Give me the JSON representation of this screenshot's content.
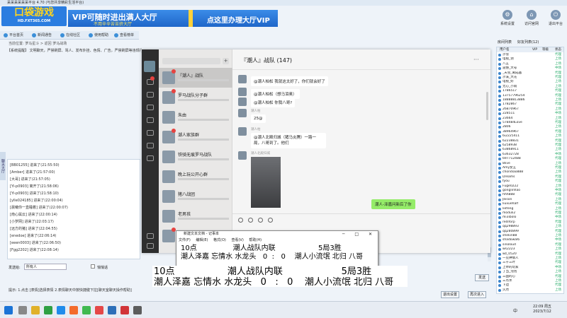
{
  "app": {
    "title": "呆呆呆呆呆呆平台 4.70 (与您共享精彩生活平台)",
    "logo": "口袋游戏",
    "logo_sub": "HD.FXT365.COM",
    "banner": {
      "line1": "VIP可随时进出满人大厅",
      "line2": "不用辛辛苦苦挤大厅",
      "line3": "点这里办理大厅VIP"
    },
    "top_icons": [
      "系统设置",
      "访问官网",
      "退出平台"
    ],
    "toolbar": [
      "平台首页",
      "新闻通告",
      "在线社区",
      "使用帮助",
      "查看榜单"
    ],
    "address": "当前位置: 罗马星斗 > 返回 罗马战场",
    "announcement": "【系统提醒】 文明聊天，严禁刷屏、骂人、发布外挂、色情、广告，严禁刷屏等违规行为",
    "side_tab": "聊天大厅",
    "messages": [
      "[BB01255] 进来了(21:55:50)",
      "[Amber] 进来了(21:57:00)",
      "[大哥] 进来了(21:57:05)",
      "[Yi-p0903] 离开了(21:58:06)",
      "[Yi-p0903] 进来了(21:58:10)",
      "[ylle024185] 进来了(22:00:04)",
      "[晨曦你一直睡着] 进来了(22:00:07)",
      "[南心属云] 进来了(22:00:14)",
      "[小罗网] 进来了(22:03:17)",
      "[远方的猪] 进来了(22:04:55)",
      "[enedoe] 进来了(22:06:14)",
      "[eeen0003] 进来了(22:06:50)",
      "[Fgg2202] 进来了(22:08:14)"
    ],
    "input_label": "发送给:",
    "input_value": "所有人",
    "check_label": "悄悄话",
    "tip": "提示: 1.点击 [表情]选择表情 2.表情聊天中按快捷键下拉[聊天室聊天操作帮助]",
    "send": "发送",
    "btn_a": "退出设置",
    "btn_b": "再次进入",
    "right_tabs": [
      "房间列表",
      "好友列表(12)"
    ],
    "user_header": [
      "用户名",
      "VIP",
      "等级",
      "状态"
    ],
    "users": [
      [
        "沙雪",
        "代理"
      ],
      [
        "电视_领",
        "上场"
      ],
      [
        "八王",
        "上场"
      ],
      [
        "遗憾_大号",
        "中场"
      ],
      [
        "_天雪_离成器",
        "代理"
      ],
      [
        "沙溪_大花",
        "代理"
      ],
      [
        "电视_好",
        "上场"
      ],
      [
        "无心_小雨",
        "上场"
      ],
      [
        "1786517",
        "代理"
      ],
      [
        "13757796254",
        "代理"
      ],
      [
        "18888813886",
        "上场"
      ],
      [
        "1782867",
        "代理"
      ],
      [
        "26870967",
        "上场"
      ],
      [
        "228511",
        "中场"
      ],
      [
        "23664",
        "上场"
      ],
      [
        "578484Love",
        "代理"
      ],
      [
        "2806",
        "上场"
      ],
      [
        "38964967",
        "代理"
      ],
      [
        "6i2225411",
        "上场"
      ],
      [
        "62238831",
        "代理"
      ],
      [
        "6258938",
        "代理"
      ],
      [
        "63868911",
        "上场"
      ],
      [
        "63632728",
        "中场"
      ],
      [
        "697712488",
        "代理"
      ],
      [
        "8live",
        "上场"
      ],
      [
        "Amy女王",
        "代理"
      ],
      [
        "chondiao888",
        "上场"
      ],
      [
        "Dreams",
        "代理"
      ],
      [
        "fyou",
        "代理"
      ],
      [
        "Fuge0222",
        "上场"
      ],
      [
        "gonglinhao",
        "中场"
      ],
      [
        "hhh888",
        "代理"
      ],
      [
        "Jeison",
        "上场"
      ],
      [
        "liuxuehalf",
        "代理"
      ],
      [
        "liefeng",
        "上场"
      ],
      [
        "moduli2",
        "代理"
      ],
      [
        "mi3ibolo",
        "中场"
      ],
      [
        "rediforp",
        "代理"
      ],
      [
        "qq298893",
        "上场"
      ],
      [
        "qq280899",
        "代理"
      ],
      [
        "shekin88",
        "上场"
      ],
      [
        "shadowal6",
        "中场"
      ],
      [
        "sinoloud",
        "代理"
      ],
      [
        "ws2223",
        "上场"
      ],
      [
        "wz_0520",
        "代理"
      ],
      [
        "一见钟情人",
        "上场"
      ],
      [
        "三十三叶",
        "代理"
      ],
      [
        "上帝的玩家",
        "中场"
      ],
      [
        "丁当_泡泡",
        "上场"
      ],
      [
        "三国的心",
        "代理"
      ],
      [
        "三点水",
        "上场"
      ],
      [
        "下边",
        "代理"
      ],
      [
        "久然",
        "上场"
      ]
    ]
  },
  "chat": {
    "list": [
      {
        "name": "『潮人』战队"
      },
      {
        "name": "罗马战队分子群"
      },
      {
        "name": "朱由"
      },
      {
        "name": "潮人家族群"
      },
      {
        "name": "铁骑无痕罗马战队"
      },
      {
        "name": "晚上玩公开心群"
      },
      {
        "name": "猪八战团"
      },
      {
        "name": "老男孩"
      },
      {
        "name": "乐园"
      }
    ],
    "title": "『潮人』战队 (147)",
    "more": "···",
    "messages": [
      {
        "sender": "",
        "text": "@潮人柏松 我就这太好了，你们就会好了"
      },
      {
        "sender": "",
        "text": "@潮人柏松（想马泪奥）"
      },
      {
        "sender": "",
        "text": "@潮人柏松 你我八哥?"
      },
      {
        "sender": "潮人枯",
        "text": "25@"
      },
      {
        "sender": "潮人枯",
        "text": "@潮人北殿归城（猪马炎腾）一路一局，八哥到了。他们"
      },
      {
        "sender": "潮人北殿归城",
        "text": ""
      }
    ],
    "green": "潮人-泽嘉问新后了你"
  },
  "notepad": {
    "title": "新建文本文档 - 记事本",
    "ctrls": "─ □ ✕",
    "menu": [
      "文件(F)",
      "编辑(E)",
      "格式(O)",
      "查看(V)",
      "帮助(H)"
    ],
    "line1": "10点                潮人战队内联                   5局3胜",
    "line2": "潮人泽嘉 忘情水 水龙头   0  :   0    潮人小流氓 北归 八哥"
  },
  "big": {
    "line1": "10点                  潮人战队内联                    5局3胜",
    "line2": "潮人泽嘉 忘情水 水龙头   0   :   0    潮人小流氓 北归 八哥"
  },
  "taskbar": {
    "time": "22:09 周五",
    "date": "2023/7/12",
    "ime": "中"
  }
}
